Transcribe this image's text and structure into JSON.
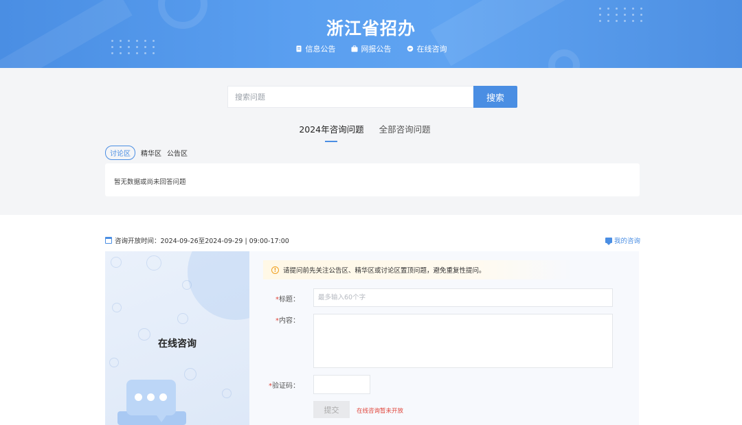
{
  "header": {
    "title": "浙江省招办",
    "nav": [
      {
        "label": "信息公告",
        "icon": "document-icon"
      },
      {
        "label": "网报公告",
        "icon": "briefcase-icon"
      },
      {
        "label": "在线咨询",
        "icon": "chat-bubble-icon"
      }
    ]
  },
  "search": {
    "placeholder": "搜索问题",
    "button_label": "搜索"
  },
  "tabs": [
    {
      "label": "2024年咨询问题",
      "active": true
    },
    {
      "label": "全部咨询问题",
      "active": false
    }
  ],
  "subtabs": [
    {
      "label": "讨论区",
      "active": true
    },
    {
      "label": "精华区",
      "active": false
    },
    {
      "label": "公告区",
      "active": false
    }
  ],
  "list": {
    "empty_text": "暂无数据或尚未回答问题"
  },
  "consult": {
    "open_time_label": "咨询开放时间：2024-09-26至2024-09-29 | 09:00-17:00",
    "my_consult_label": "我的咨询",
    "panel_title": "在线咨询",
    "notice": "请提问前先关注公告区、精华区或讨论区置顶问题，避免重复性提问。",
    "form": {
      "title_label": "标题：",
      "title_placeholder": "最多输入60个字",
      "content_label": "内容：",
      "captcha_label": "验证码：",
      "required_mark": "*",
      "submit_label": "提交",
      "closed_hint": "在线咨询暂未开放"
    }
  },
  "colors": {
    "brand": "#4a8ee3",
    "required": "#e0453a",
    "warning": "#f0a020"
  }
}
